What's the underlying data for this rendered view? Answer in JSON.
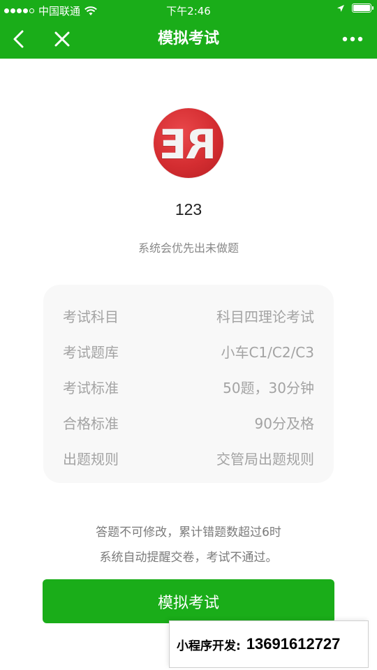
{
  "status_bar": {
    "carrier": "中国联通",
    "time": "下午2:46"
  },
  "nav": {
    "title": "模拟考试",
    "back_icon": "chevron-left-icon",
    "close_icon": "close-icon",
    "more_icon": "more-icon"
  },
  "profile": {
    "avatar_text": "RE",
    "name": "123",
    "subtitle": "系统会优先出未做题"
  },
  "exam_info": {
    "rows": [
      {
        "label": "考试科目",
        "value": "科目四理论考试"
      },
      {
        "label": "考试题库",
        "value": "小车C1/C2/C3"
      },
      {
        "label": "考试标准",
        "value": "50题，30分钟"
      },
      {
        "label": "合格标准",
        "value": "90分及格"
      },
      {
        "label": "出题规则",
        "value": "交管局出题规则"
      }
    ]
  },
  "notice": {
    "line1": "答题不可修改，累计错题数超过6时",
    "line2": "系统自动提醒交卷，考试不通过。"
  },
  "start_button": {
    "label": "模拟考试"
  },
  "watermark": {
    "label": "小程序开发:",
    "phone": "13691612727"
  },
  "colors": {
    "brand_green": "#1aad19",
    "card_bg": "#f8f8f8",
    "muted_text": "#a3a3a3"
  }
}
